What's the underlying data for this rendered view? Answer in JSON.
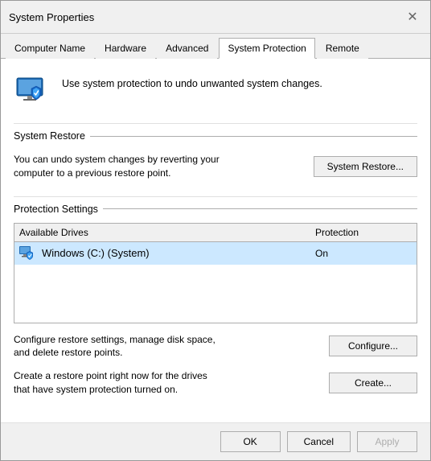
{
  "window": {
    "title": "System Properties"
  },
  "tabs": [
    {
      "id": "computer-name",
      "label": "Computer Name",
      "active": false
    },
    {
      "id": "hardware",
      "label": "Hardware",
      "active": false
    },
    {
      "id": "advanced",
      "label": "Advanced",
      "active": false
    },
    {
      "id": "system-protection",
      "label": "System Protection",
      "active": true
    },
    {
      "id": "remote",
      "label": "Remote",
      "active": false
    }
  ],
  "info": {
    "text": "Use system protection to undo unwanted system changes."
  },
  "system_restore": {
    "section_title": "System Restore",
    "description": "You can undo system changes by reverting\nyour computer to a previous restore point.",
    "button_label": "System Restore..."
  },
  "protection_settings": {
    "section_title": "Protection Settings",
    "table": {
      "col_drive": "Available Drives",
      "col_protection": "Protection",
      "rows": [
        {
          "drive": "Windows (C:) (System)",
          "protection": "On"
        }
      ]
    },
    "configure_desc": "Configure restore settings, manage disk space, and\ndelete restore points.",
    "configure_label": "Configure...",
    "create_desc": "Create a restore point right now for the drives that\nhave system protection turned on.",
    "create_label": "Create..."
  },
  "footer": {
    "ok_label": "OK",
    "cancel_label": "Cancel",
    "apply_label": "Apply"
  }
}
